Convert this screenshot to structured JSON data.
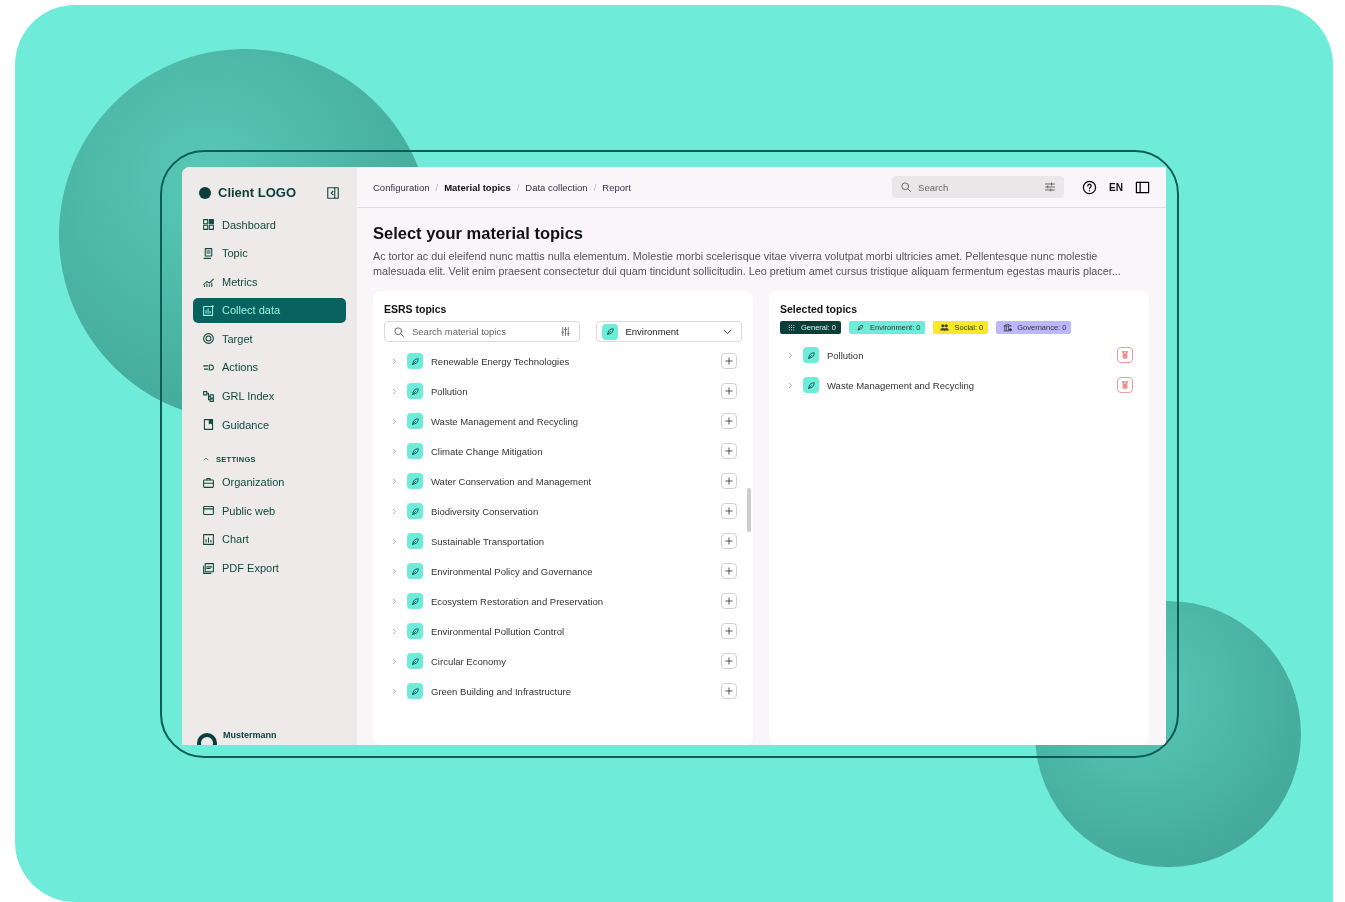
{
  "sidebar": {
    "logo": "Client LOGO",
    "items": [
      {
        "label": "Dashboard",
        "selected": false
      },
      {
        "label": "Topic",
        "selected": false
      },
      {
        "label": "Metrics",
        "selected": false
      },
      {
        "label": "Collect data",
        "selected": true
      },
      {
        "label": "Target",
        "selected": false
      },
      {
        "label": "Actions",
        "selected": false
      },
      {
        "label": "GRL Index",
        "selected": false
      },
      {
        "label": "Guidance",
        "selected": false
      }
    ],
    "settings": {
      "label": "SETTINGS",
      "expanded": true,
      "items": [
        {
          "label": "Organization",
          "selected": false
        },
        {
          "label": "Public web",
          "selected": false
        },
        {
          "label": "Chart",
          "selected": false
        },
        {
          "label": "PDF Export",
          "selected": false
        }
      ]
    },
    "user": "Mustermann"
  },
  "breadcrumbs": [
    {
      "label": "Configuration",
      "selected": false
    },
    {
      "separator": "/",
      "label": "Material topics",
      "selected": true
    },
    {
      "separator": "/",
      "label": "Data collection",
      "selected": false
    },
    {
      "separator": "/",
      "label": "Report",
      "selected": false
    }
  ],
  "search": {
    "placeholder": "Search"
  },
  "language": "EN",
  "page": {
    "title": "Select your material topics",
    "description": "Ac tortor ac dui eleifend nunc mattis nulla elementum. Molestie morbi scelerisque vitae viverra volutpat morbi ultricies amet. Pellentesque nunc molestie malesuada elit. Velit enim praesent consectetur dui quam tincidunt sollicitudin. Leo pretium amet cursus tristique aliquam fermentum egestas mauris placer..."
  },
  "esrs": {
    "title": "ESRS topics",
    "search_placeholder": "Search material topics",
    "category": "Environment",
    "topics": [
      "Renewable Energy Technologies",
      "Pollution",
      "Waste Management and Recycling",
      "Climate Change Mitigation",
      "Water Conservation and Management",
      "Biodiversity Conservation",
      "Sustainable Transportation",
      "Environmental Policy and Governance",
      "Ecosystem Restoration and Preservation",
      "Environmental Pollution Control",
      "Circular Economy",
      "Green Building and Infrastructure"
    ]
  },
  "selected": {
    "title": "Selected topics",
    "tags": [
      {
        "label": "General: 0",
        "color": "#0b3d3a"
      },
      {
        "label": "Environment: 0",
        "color": "#6eecd9"
      },
      {
        "label": "Social: 0",
        "color": "#f5e92a"
      },
      {
        "label": "Governance: 0",
        "color": "#bdb8fb"
      }
    ],
    "topics": [
      "Pollution",
      "Waste Management and Recycling"
    ]
  }
}
